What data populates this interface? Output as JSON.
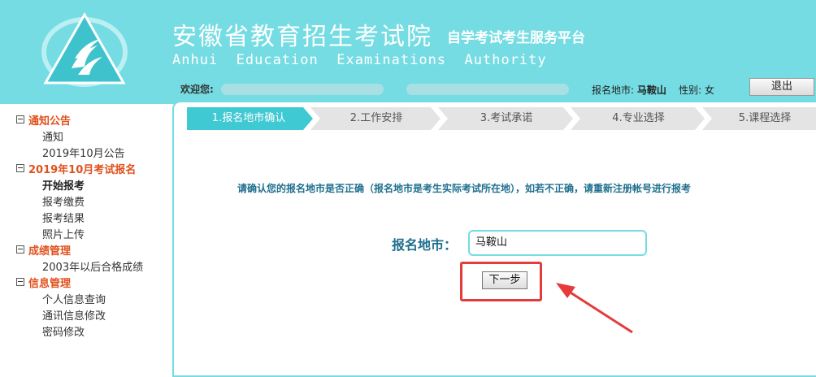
{
  "header": {
    "title_cn": "安徽省教育招生考试院",
    "subtitle_cn": "自学考试考生服务平台",
    "title_en": "Anhui  Education  Examinations  Authority"
  },
  "user_bar": {
    "welcome_label": "欢迎您:",
    "exam_city_label": "报名地市:",
    "exam_city_value": "马鞍山",
    "gender_label": "性别:",
    "gender_value": "女",
    "logout_label": "退出"
  },
  "sidebar": {
    "cat_notice": "通知公告",
    "item_notice": "通知",
    "item_oct_announce": "2019年10月公告",
    "cat_registration": "2019年10月考试报名",
    "item_start": "开始报考",
    "item_pay": "报考缴费",
    "item_result": "报考结果",
    "item_photo": "照片上传",
    "cat_grades": "成绩管理",
    "item_grades_2003": "2003年以后合格成绩",
    "cat_info": "信息管理",
    "item_personal": "个人信息查询",
    "item_contact": "通讯信息修改",
    "item_password": "密码修改"
  },
  "steps": {
    "s1": "1.报名地市确认",
    "s2": "2.工作安排",
    "s3": "3.考试承诺",
    "s4": "4.专业选择",
    "s5": "5.课程选择"
  },
  "main": {
    "note": "请确认您的报名地市是否正确（报名地市是考生实际考试所在地），如若不正确，请重新注册帐号进行报考",
    "city_label": "报名地市：",
    "city_value": "马鞍山",
    "next_label": "下一步"
  },
  "colors": {
    "header_bg": "#74dce2",
    "active_step": "#3fc9d3",
    "inactive_step": "#e6e6e6",
    "category_orange": "#e0511c",
    "note_teal": "#1f6f8e",
    "highlight_red": "#e53b3b"
  },
  "icons": {
    "logo": "triangle-flame-logo-icon",
    "collapse": "minus-box-icon",
    "pointer": "red-arrow-icon"
  }
}
